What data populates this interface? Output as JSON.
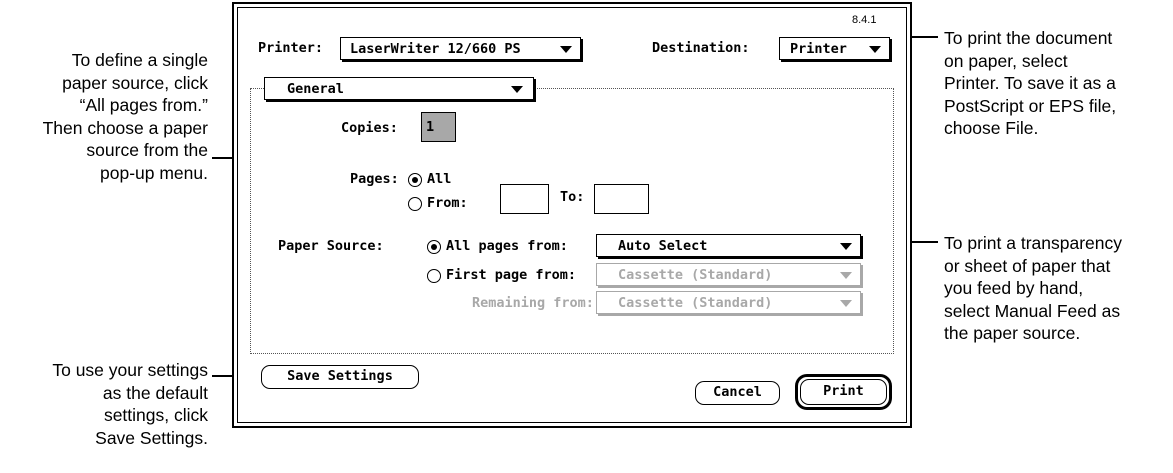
{
  "callouts": {
    "single_source": [
      "To define a single",
      "paper source, click",
      "“All pages from.”",
      "Then choose a paper",
      "source from the",
      "pop-up menu."
    ],
    "save_settings": [
      "To use your settings",
      "as the default",
      "settings, click",
      "Save Settings."
    ],
    "destination": [
      "To print the document",
      "on paper, select",
      "Printer. To save it as a",
      "PostScript or EPS file,",
      "choose File."
    ],
    "manual_feed": [
      "To print a transparency",
      "or sheet of paper that",
      "you feed by hand,",
      "select Manual Feed as",
      "the paper source."
    ]
  },
  "dialog": {
    "version": "8.4.1",
    "printer_label": "Printer:",
    "printer_value": "LaserWriter 12/660 PS",
    "destination_label": "Destination:",
    "destination_value": "Printer",
    "panel_value": "General",
    "copies_label": "Copies:",
    "copies_value": "1",
    "pages_label": "Pages:",
    "pages_all": "All",
    "pages_from": "From:",
    "pages_to": "To:",
    "pages_from_value": "",
    "pages_to_value": "",
    "paper_source_label": "Paper Source:",
    "all_pages_from": "All pages from:",
    "all_pages_from_value": "Auto Select",
    "first_page_from": "First page from:",
    "first_page_from_value": "Cassette (Standard)",
    "remaining_from": "Remaining from:",
    "remaining_from_value": "Cassette (Standard)",
    "save_settings_button": "Save Settings",
    "cancel_button": "Cancel",
    "print_button": "Print"
  }
}
